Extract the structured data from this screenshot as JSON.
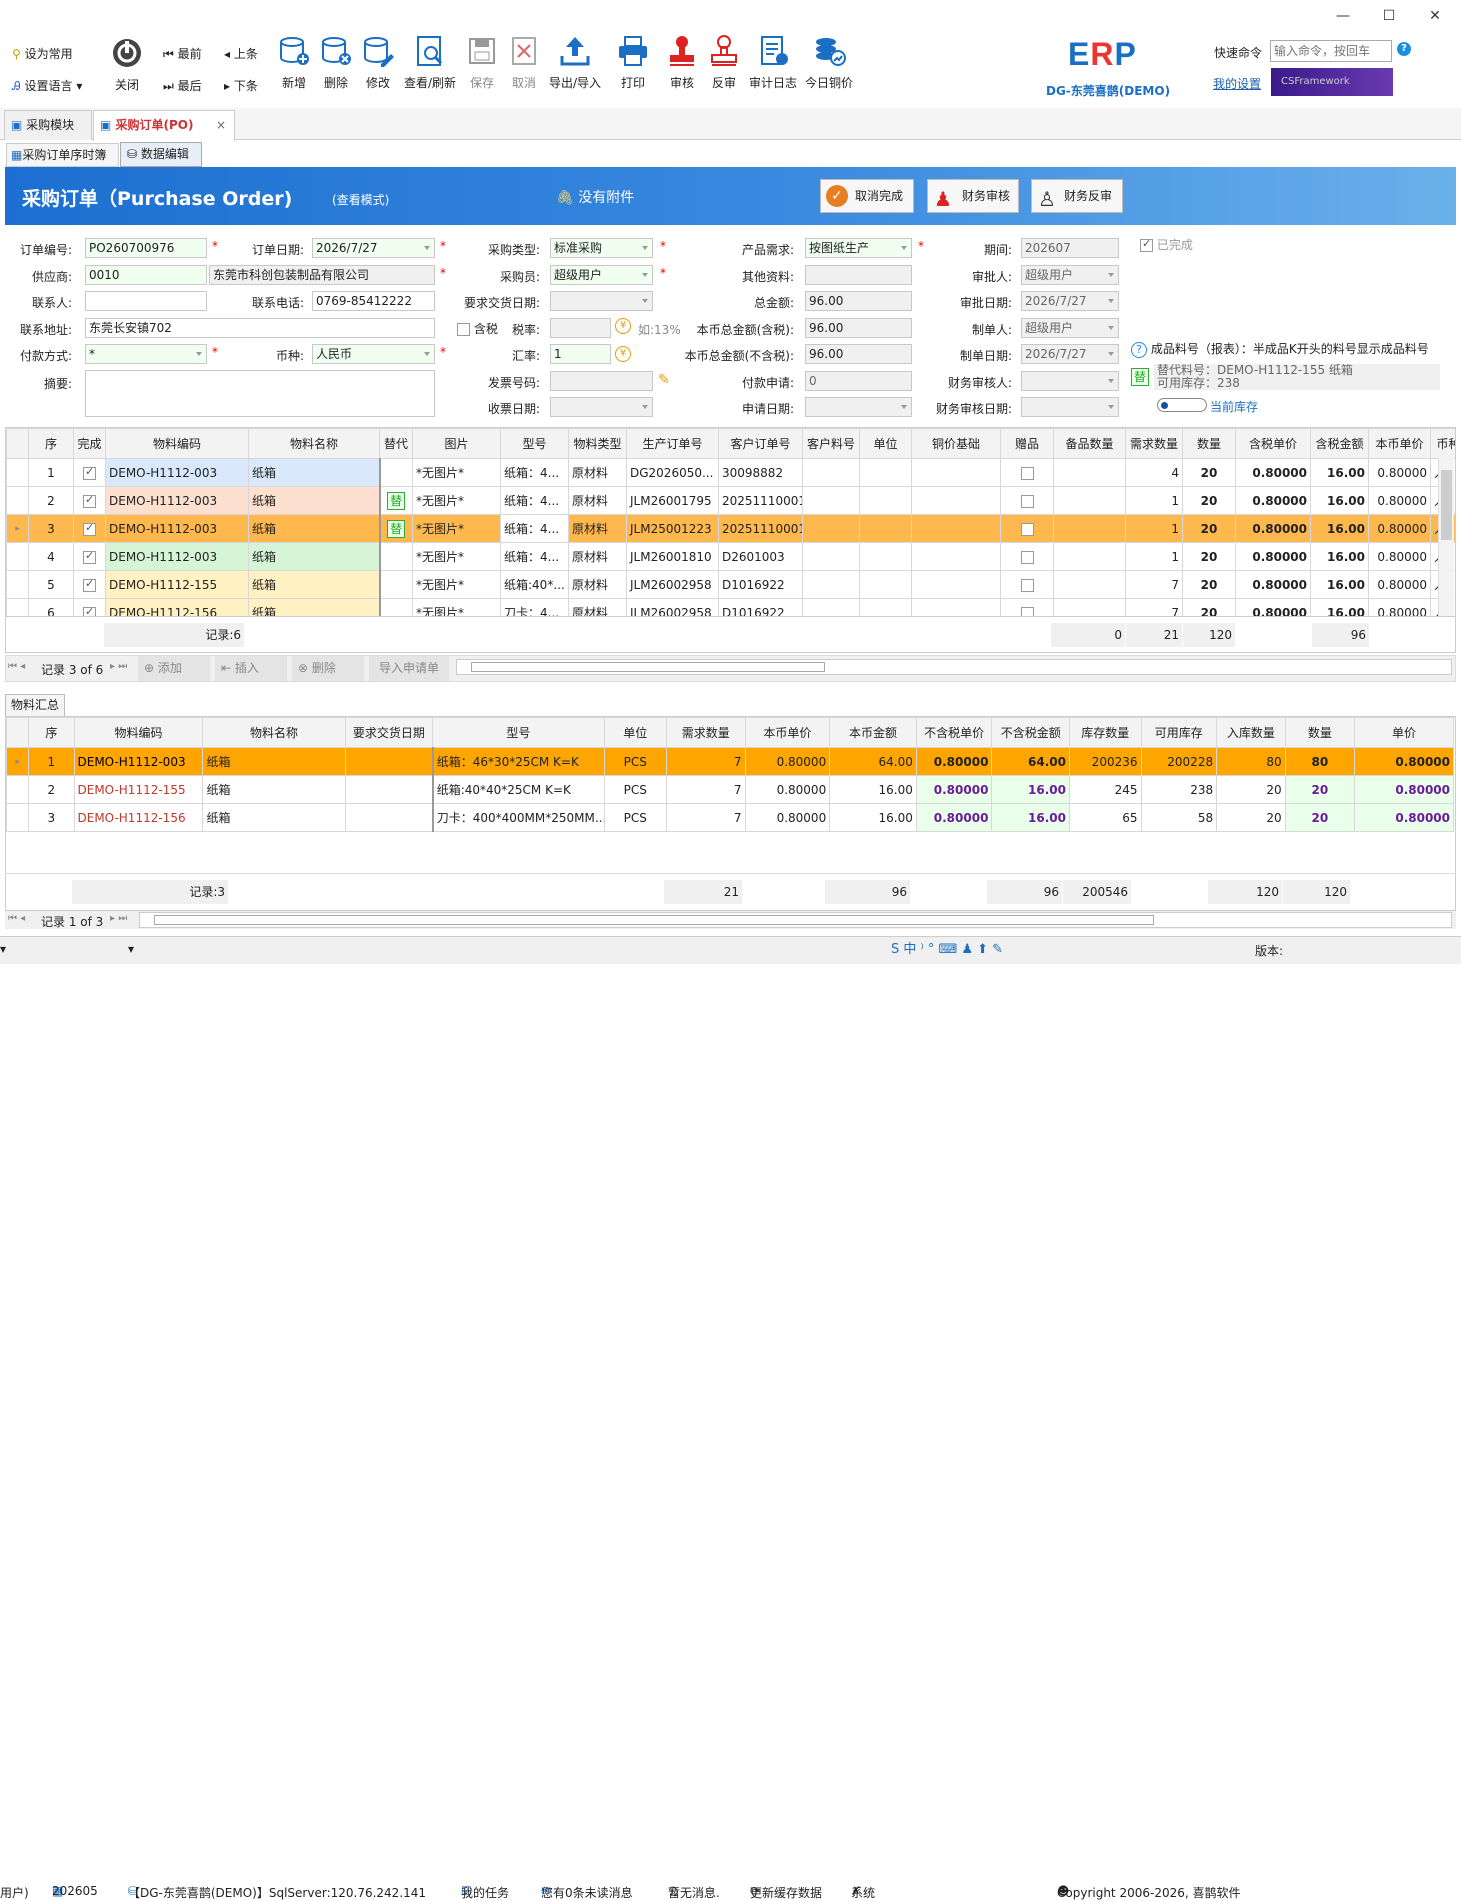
{
  "toolbar": {
    "set_common": "设为常用",
    "set_lang": "设置语言",
    "close": "关闭",
    "first": "最前",
    "last": "最后",
    "prev": "上条",
    "next": "下条",
    "add": "新增",
    "delete": "删除",
    "edit": "修改",
    "view": "查看/刷新",
    "save": "保存",
    "cancel": "取消",
    "export": "导出/导入",
    "print": "打印",
    "approve": "审核",
    "unapprove": "反审",
    "audit_log": "审计日志",
    "copper": "今日铜价"
  },
  "brand": {
    "company": "DG-东莞喜鹊(DEMO)",
    "quick_cmd": "快速命令",
    "quick_placeholder": "输入命令，按回车",
    "my_settings": "我的设置",
    "banner": "CSFramework"
  },
  "tabs": {
    "purchase_module": "采购模块",
    "purchase_order": "采购订单(PO)",
    "sub1": "采购订单序时簿",
    "sub2": "数据编辑"
  },
  "header": {
    "title": "采购订单（Purchase Order)",
    "mode": "(查看模式)",
    "attachment": "没有附件",
    "btn_cancel_done": "取消完成",
    "btn_fin_approve": "财务审核",
    "btn_fin_unapprove": "财务反审"
  },
  "form": {
    "order_no_l": "订单编号:",
    "order_no": "PO260700976",
    "order_date_l": "订单日期:",
    "order_date": "2026/7/27",
    "ptype_l": "采购类型:",
    "ptype": "标准采购",
    "demand_l": "产品需求:",
    "demand": "按图纸生产",
    "period_l": "期间:",
    "period": "202607",
    "done": "已完成",
    "supplier_l": "供应商:",
    "supplier_code": "0010",
    "supplier_name": "东莞市科创包装制品有限公司",
    "buyer_l": "采购员:",
    "buyer": "超级用户",
    "other_l": "其他资料:",
    "approver_l": "审批人:",
    "approver": "超级用户",
    "contact_l": "联系人:",
    "phone_l": "联系电话:",
    "phone": "0769-85412222",
    "req_date_l": "要求交货日期:",
    "total_l": "总金额:",
    "total": "96.00",
    "approve_date_l": "审批日期:",
    "approve_date": "2026/7/27",
    "addr_l": "联系地址:",
    "addr": "东莞长安镇702",
    "tax_chk": "含税",
    "tax_rate_l": "税率:",
    "tax_hint": "如:13%",
    "total_tax_l": "本币总金额(含税):",
    "total_tax": "96.00",
    "maker_l": "制单人:",
    "maker": "超级用户",
    "pay_l": "付款方式:",
    "pay": "*",
    "currency_l": "币种:",
    "currency": "人民币",
    "rate_l": "汇率:",
    "rate": "1",
    "total_notax_l": "本币总金额(不含税):",
    "total_notax": "96.00",
    "make_date_l": "制单日期:",
    "make_date": "2026/7/27",
    "summary_l": "摘要:",
    "invoice_l": "发票号码:",
    "pay_req_l": "付款申请:",
    "pay_req": "0",
    "fin_approver_l": "财务审核人:",
    "receive_l": "收票日期:",
    "apply_l": "申请日期:",
    "fin_date_l": "财务审核日期:",
    "info_text": "成品料号（报表）：半成品K开头的料号显示成品料号",
    "sub_code": "替代料号：DEMO-H1112-155 纸箱",
    "avail_stock": "可用库存：238",
    "current_stock": "当前库存"
  },
  "grid1": {
    "cols": [
      "序",
      "完成",
      "物料编码",
      "物料名称",
      "替代",
      "图片",
      "型号",
      "物料类型",
      "生产订单号",
      "客户订单号",
      "客户料号",
      "单位",
      "铜价基础",
      "赠品",
      "备品数量",
      "需求数量",
      "数量",
      "含税单价",
      "含税金额",
      "本币单价",
      "币种"
    ],
    "rows": [
      {
        "n": "1",
        "code": "DEMO-H1112-003",
        "name": "纸箱",
        "sub": "",
        "img": "*无图片*",
        "model": "纸箱：4...",
        "type": "原材料",
        "po": "DG2026050...",
        "co": "30098882",
        "req": "4",
        "qty": "20",
        "up": "0.80000",
        "amt": "16.00",
        "lup": "0.80000",
        "cur": "人"
      },
      {
        "n": "2",
        "code": "DEMO-H1112-003",
        "name": "纸箱",
        "sub": "替",
        "img": "*无图片*",
        "model": "纸箱：4...",
        "type": "原材料",
        "po": "JLM26001795",
        "co": "20251110001",
        "req": "1",
        "qty": "20",
        "up": "0.80000",
        "amt": "16.00",
        "lup": "0.80000",
        "cur": "人"
      },
      {
        "n": "3",
        "code": "DEMO-H1112-003",
        "name": "纸箱",
        "sub": "替",
        "img": "*无图片*",
        "model": "纸箱：4...",
        "type": "原材料",
        "po": "JLM25001223",
        "co": "20251110001",
        "req": "1",
        "qty": "20",
        "up": "0.80000",
        "amt": "16.00",
        "lup": "0.80000",
        "cur": "人"
      },
      {
        "n": "4",
        "code": "DEMO-H1112-003",
        "name": "纸箱",
        "sub": "",
        "img": "*无图片*",
        "model": "纸箱：4...",
        "type": "原材料",
        "po": "JLM26001810",
        "co": "D2601003",
        "req": "1",
        "qty": "20",
        "up": "0.80000",
        "amt": "16.00",
        "lup": "0.80000",
        "cur": "人"
      },
      {
        "n": "5",
        "code": "DEMO-H1112-155",
        "name": "纸箱",
        "sub": "",
        "img": "*无图片*",
        "model": "纸箱:40*...",
        "type": "原材料",
        "po": "JLM26002958",
        "co": "D1016922",
        "req": "7",
        "qty": "20",
        "up": "0.80000",
        "amt": "16.00",
        "lup": "0.80000",
        "cur": "人"
      },
      {
        "n": "6",
        "code": "DEMO-H1112-156",
        "name": "纸箱",
        "sub": "",
        "img": "*无图片*",
        "model": "刀卡：4...",
        "type": "原材料",
        "po": "JLM26002958",
        "co": "D1016922",
        "req": "7",
        "qty": "20",
        "up": "0.80000",
        "amt": "16.00",
        "lup": "0.80000",
        "cur": "人"
      }
    ],
    "records": "记录:6",
    "sum_spare": "0",
    "sum_req": "21",
    "sum_qty": "120",
    "sum_amt": "96",
    "nav": "记录 3 of 6",
    "btn_add": "添加",
    "btn_insert": "插入",
    "btn_del": "删除",
    "btn_import": "导入申请单"
  },
  "grid2": {
    "tab": "物料汇总",
    "cols": [
      "序",
      "物料编码",
      "物料名称",
      "要求交货日期",
      "型号",
      "单位",
      "需求数量",
      "本币单价",
      "本币金额",
      "不含税单价",
      "不含税金额",
      "库存数量",
      "可用库存",
      "入库数量",
      "数量",
      "单价"
    ],
    "rows": [
      {
        "n": "1",
        "code": "DEMO-H1112-003",
        "name": "纸箱",
        "model": "纸箱：46*30*25CM K=K",
        "unit": "PCS",
        "req": "7",
        "lup": "0.80000",
        "lamt": "64.00",
        "nup": "0.80000",
        "namt": "64.00",
        "stock": "200236",
        "avail": "200228",
        "in": "80",
        "qty": "80",
        "price": "0.80000"
      },
      {
        "n": "2",
        "code": "DEMO-H1112-155",
        "name": "纸箱",
        "model": "纸箱:40*40*25CM K=K",
        "unit": "PCS",
        "req": "7",
        "lup": "0.80000",
        "lamt": "16.00",
        "nup": "0.80000",
        "namt": "16.00",
        "stock": "245",
        "avail": "238",
        "in": "20",
        "qty": "20",
        "price": "0.80000"
      },
      {
        "n": "3",
        "code": "DEMO-H1112-156",
        "name": "纸箱",
        "model": "刀卡：400*400MM*250MM...",
        "unit": "PCS",
        "req": "7",
        "lup": "0.80000",
        "lamt": "16.00",
        "nup": "0.80000",
        "namt": "16.00",
        "stock": "65",
        "avail": "58",
        "in": "20",
        "qty": "20",
        "price": "0.80000"
      }
    ],
    "records": "记录:3",
    "sum_req": "21",
    "sum_lamt": "96",
    "sum_namt": "96",
    "sum_stock": "200546",
    "sum_in": "120",
    "sum_qty": "120",
    "nav": "记录 1 of 3"
  },
  "status": {
    "user": "用户)",
    "period": "202605",
    "db": "【DG-东莞喜鹊(DEMO)】SqlServer:120.76.242.141",
    "tasks": "我的任务",
    "unread": "您有0条未读消息",
    "nomsg": "暂无消息.",
    "cache": "更新缓存数据",
    "sys": "系统",
    "copyright": "Copyright 2006-2026, 喜鹊软件",
    "version": "版本:"
  }
}
